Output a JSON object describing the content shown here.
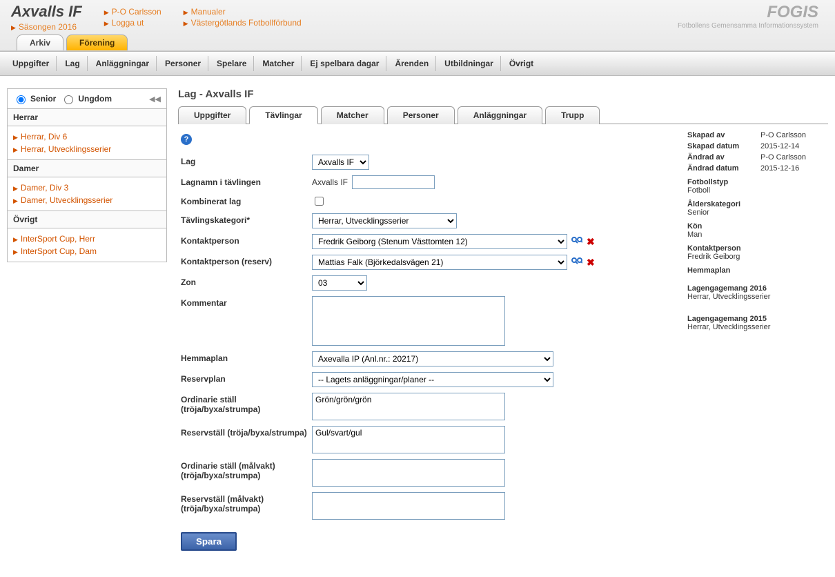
{
  "header": {
    "app_title": "Axvalls IF",
    "links_col1": [
      "Säsongen 2016"
    ],
    "links_col2": [
      "P-O Carlsson",
      "Logga ut"
    ],
    "links_col3": [
      "Manualer",
      "Västergötlands Fotbollförbund"
    ],
    "brand_title": "FOGIS",
    "brand_sub": "Fotbollens Gemensamma Informationssystem"
  },
  "top_tabs": {
    "arkiv": "Arkiv",
    "forening": "Förening"
  },
  "navbar": [
    "Uppgifter",
    "Lag",
    "Anläggningar",
    "Personer",
    "Spelare",
    "Matcher",
    "Ej spelbara dagar",
    "Ärenden",
    "Utbildningar",
    "Övrigt"
  ],
  "sidebar": {
    "senior_label": "Senior",
    "ungdom_label": "Ungdom",
    "herrar_hdr": "Herrar",
    "herrar_links": [
      "Herrar, Div 6",
      "Herrar, Utvecklingsserier"
    ],
    "damer_hdr": "Damer",
    "damer_links": [
      "Damer, Div 3",
      "Damer, Utvecklingsserier"
    ],
    "ovrigt_hdr": "Övrigt",
    "ovrigt_links": [
      "InterSport Cup, Herr",
      "InterSport Cup, Dam"
    ]
  },
  "main": {
    "page_title": "Lag - Axvalls IF",
    "subtabs": {
      "uppgifter": "Uppgifter",
      "tavlingar": "Tävlingar",
      "matcher": "Matcher",
      "personer": "Personer",
      "anlaggningar": "Anläggningar",
      "trupp": "Trupp"
    },
    "labels": {
      "lag": "Lag",
      "lagnamn": "Lagnamn i tävlingen",
      "kombinerat": "Kombinerat lag",
      "tavlingskat": "Tävlingskategori*",
      "kontakt": "Kontaktperson",
      "kontakt_reserv": "Kontaktperson (reserv)",
      "zon": "Zon",
      "kommentar": "Kommentar",
      "hemmaplan": "Hemmaplan",
      "reservplan": "Reservplan",
      "ord_stall": "Ordinarie ställ (tröja/byxa/strumpa)",
      "reservstall": "Reservställ (tröja/byxa/strumpa)",
      "ord_stall_mv": "Ordinarie ställ (målvakt) (tröja/byxa/strumpa)",
      "reservstall_mv": "Reservställ (målvakt) (tröja/byxa/strumpa)"
    },
    "values": {
      "lag_select": "Axvalls IF",
      "lagnamn_text": "Axvalls IF",
      "lagnamn_input": "",
      "tavlingskat": "Herrar, Utvecklingsserier",
      "kontakt": "Fredrik Geiborg (Stenum Västtomten 12)",
      "kontakt_reserv": "Mattias Falk (Björkedalsvägen 21)",
      "zon": "03",
      "kommentar": "",
      "hemmaplan": "Axevalla IP (Anl.nr.: 20217)",
      "reservplan": "-- Lagets anläggningar/planer --",
      "ord_stall": "Grön/grön/grön",
      "reservstall": "Gul/svart/gul",
      "ord_stall_mv": "",
      "reservstall_mv": ""
    },
    "save_btn": "Spara"
  },
  "info": {
    "skapad_av_k": "Skapad av",
    "skapad_av_v": "P-O Carlsson",
    "skapad_datum_k": "Skapad datum",
    "skapad_datum_v": "2015-12-14",
    "andrad_av_k": "Ändrad av",
    "andrad_av_v": "P-O Carlsson",
    "andrad_datum_k": "Ändrad datum",
    "andrad_datum_v": "2015-12-16",
    "fotbollstyp_k": "Fotbollstyp",
    "fotbollstyp_v": "Fotboll",
    "alderskat_k": "Ålderskategori",
    "alderskat_v": "Senior",
    "kon_k": "Kön",
    "kon_v": "Man",
    "kontakt_k": "Kontaktperson",
    "kontakt_v": "Fredrik Geiborg",
    "hemmaplan_k": "Hemmaplan",
    "lageng2016_k": "Lagengagemang  2016",
    "lageng2016_v": "Herrar, Utvecklingsserier",
    "lageng2015_k": "Lagengagemang  2015",
    "lageng2015_v": "Herrar, Utvecklingsserier"
  }
}
